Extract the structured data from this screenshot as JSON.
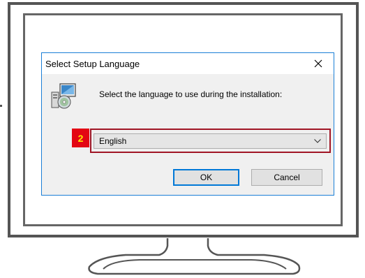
{
  "dialog": {
    "title": "Select Setup Language",
    "prompt": "Select the language to use during the installation:",
    "language_select": {
      "selected": "English"
    },
    "ok_label": "OK",
    "cancel_label": "Cancel"
  },
  "annotation": {
    "step_number": "2",
    "badge_color": "#e30613",
    "number_color": "#ffe600",
    "frame_color": "#a01525"
  },
  "icons": {
    "close": "close-icon",
    "setup": "setup-installer-icon",
    "dropdown": "chevron-down-icon"
  }
}
